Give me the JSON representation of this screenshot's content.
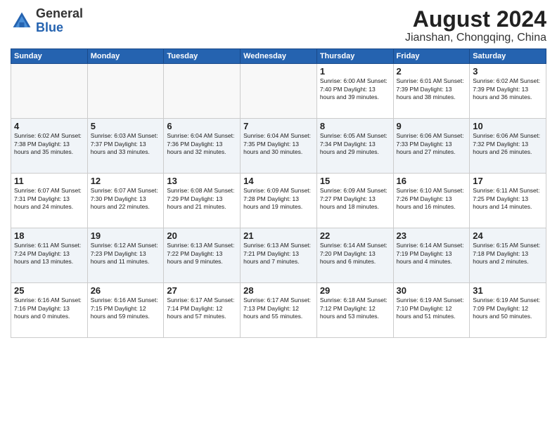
{
  "header": {
    "logo_general": "General",
    "logo_blue": "Blue",
    "month_year": "August 2024",
    "location": "Jianshan, Chongqing, China"
  },
  "days_of_week": [
    "Sunday",
    "Monday",
    "Tuesday",
    "Wednesday",
    "Thursday",
    "Friday",
    "Saturday"
  ],
  "weeks": [
    [
      {
        "day": "",
        "info": ""
      },
      {
        "day": "",
        "info": ""
      },
      {
        "day": "",
        "info": ""
      },
      {
        "day": "",
        "info": ""
      },
      {
        "day": "1",
        "info": "Sunrise: 6:00 AM\nSunset: 7:40 PM\nDaylight: 13 hours\nand 39 minutes."
      },
      {
        "day": "2",
        "info": "Sunrise: 6:01 AM\nSunset: 7:39 PM\nDaylight: 13 hours\nand 38 minutes."
      },
      {
        "day": "3",
        "info": "Sunrise: 6:02 AM\nSunset: 7:39 PM\nDaylight: 13 hours\nand 36 minutes."
      }
    ],
    [
      {
        "day": "4",
        "info": "Sunrise: 6:02 AM\nSunset: 7:38 PM\nDaylight: 13 hours\nand 35 minutes."
      },
      {
        "day": "5",
        "info": "Sunrise: 6:03 AM\nSunset: 7:37 PM\nDaylight: 13 hours\nand 33 minutes."
      },
      {
        "day": "6",
        "info": "Sunrise: 6:04 AM\nSunset: 7:36 PM\nDaylight: 13 hours\nand 32 minutes."
      },
      {
        "day": "7",
        "info": "Sunrise: 6:04 AM\nSunset: 7:35 PM\nDaylight: 13 hours\nand 30 minutes."
      },
      {
        "day": "8",
        "info": "Sunrise: 6:05 AM\nSunset: 7:34 PM\nDaylight: 13 hours\nand 29 minutes."
      },
      {
        "day": "9",
        "info": "Sunrise: 6:06 AM\nSunset: 7:33 PM\nDaylight: 13 hours\nand 27 minutes."
      },
      {
        "day": "10",
        "info": "Sunrise: 6:06 AM\nSunset: 7:32 PM\nDaylight: 13 hours\nand 26 minutes."
      }
    ],
    [
      {
        "day": "11",
        "info": "Sunrise: 6:07 AM\nSunset: 7:31 PM\nDaylight: 13 hours\nand 24 minutes."
      },
      {
        "day": "12",
        "info": "Sunrise: 6:07 AM\nSunset: 7:30 PM\nDaylight: 13 hours\nand 22 minutes."
      },
      {
        "day": "13",
        "info": "Sunrise: 6:08 AM\nSunset: 7:29 PM\nDaylight: 13 hours\nand 21 minutes."
      },
      {
        "day": "14",
        "info": "Sunrise: 6:09 AM\nSunset: 7:28 PM\nDaylight: 13 hours\nand 19 minutes."
      },
      {
        "day": "15",
        "info": "Sunrise: 6:09 AM\nSunset: 7:27 PM\nDaylight: 13 hours\nand 18 minutes."
      },
      {
        "day": "16",
        "info": "Sunrise: 6:10 AM\nSunset: 7:26 PM\nDaylight: 13 hours\nand 16 minutes."
      },
      {
        "day": "17",
        "info": "Sunrise: 6:11 AM\nSunset: 7:25 PM\nDaylight: 13 hours\nand 14 minutes."
      }
    ],
    [
      {
        "day": "18",
        "info": "Sunrise: 6:11 AM\nSunset: 7:24 PM\nDaylight: 13 hours\nand 13 minutes."
      },
      {
        "day": "19",
        "info": "Sunrise: 6:12 AM\nSunset: 7:23 PM\nDaylight: 13 hours\nand 11 minutes."
      },
      {
        "day": "20",
        "info": "Sunrise: 6:13 AM\nSunset: 7:22 PM\nDaylight: 13 hours\nand 9 minutes."
      },
      {
        "day": "21",
        "info": "Sunrise: 6:13 AM\nSunset: 7:21 PM\nDaylight: 13 hours\nand 7 minutes."
      },
      {
        "day": "22",
        "info": "Sunrise: 6:14 AM\nSunset: 7:20 PM\nDaylight: 13 hours\nand 6 minutes."
      },
      {
        "day": "23",
        "info": "Sunrise: 6:14 AM\nSunset: 7:19 PM\nDaylight: 13 hours\nand 4 minutes."
      },
      {
        "day": "24",
        "info": "Sunrise: 6:15 AM\nSunset: 7:18 PM\nDaylight: 13 hours\nand 2 minutes."
      }
    ],
    [
      {
        "day": "25",
        "info": "Sunrise: 6:16 AM\nSunset: 7:16 PM\nDaylight: 13 hours\nand 0 minutes."
      },
      {
        "day": "26",
        "info": "Sunrise: 6:16 AM\nSunset: 7:15 PM\nDaylight: 12 hours\nand 59 minutes."
      },
      {
        "day": "27",
        "info": "Sunrise: 6:17 AM\nSunset: 7:14 PM\nDaylight: 12 hours\nand 57 minutes."
      },
      {
        "day": "28",
        "info": "Sunrise: 6:17 AM\nSunset: 7:13 PM\nDaylight: 12 hours\nand 55 minutes."
      },
      {
        "day": "29",
        "info": "Sunrise: 6:18 AM\nSunset: 7:12 PM\nDaylight: 12 hours\nand 53 minutes."
      },
      {
        "day": "30",
        "info": "Sunrise: 6:19 AM\nSunset: 7:10 PM\nDaylight: 12 hours\nand 51 minutes."
      },
      {
        "day": "31",
        "info": "Sunrise: 6:19 AM\nSunset: 7:09 PM\nDaylight: 12 hours\nand 50 minutes."
      }
    ]
  ]
}
